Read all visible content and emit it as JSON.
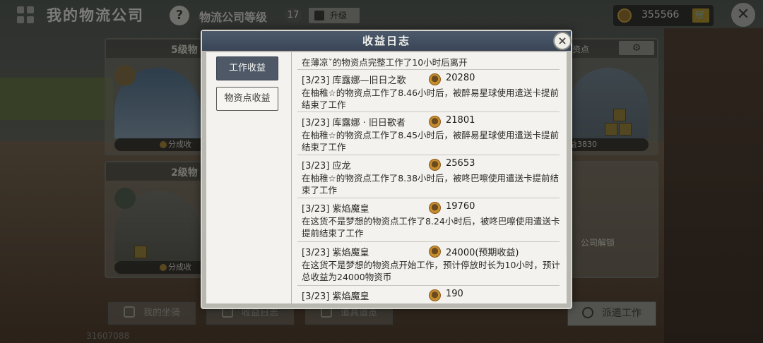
{
  "topbar": {
    "title": "我的物流公司",
    "help": "?",
    "level_label": "物流公司等级",
    "level_value": "17",
    "upgrade_label": "升级",
    "coins": "355566"
  },
  "cards": {
    "left_top_level": "5级物",
    "left_top_strip": "分成收",
    "left_bottom_level": "2级物",
    "left_bottom_strip": "分成收",
    "right_top_label": "资点",
    "right_top_strip": "益3830",
    "right_bottom_label": "公司解锁"
  },
  "bottom": {
    "mount_label": "我的坐骑",
    "log_label": "收益日志",
    "items_label": "道具道览",
    "dispatch_label": "派遣工作",
    "uid": "31607088"
  },
  "modal": {
    "title": "收益日志",
    "close": "×",
    "tabs": [
      "工作收益",
      "物资点收益"
    ],
    "top_partial": "在薄凉ˇ的物资点完整工作了10小时后离开",
    "entries": [
      {
        "date_name": "[3/23] 库露娜—旧日之歌",
        "amount": "20280",
        "desc": "在柚稚☆的物资点工作了8.46小时后，被醉易星球使用遣送卡提前结束了工作"
      },
      {
        "date_name": "[3/23] 库露娜 · 旧日歌者",
        "amount": "21801",
        "desc": "在柚稚☆的物资点工作了8.45小时后，被醉易星球使用遣送卡提前结束了工作"
      },
      {
        "date_name": "[3/23] 应龙",
        "amount": "25653",
        "desc": "在柚稚☆的物资点工作了8.38小时后，被咚巴嚓使用遣送卡提前结束了工作"
      },
      {
        "date_name": "[3/23] 紫焰魔皇",
        "amount": "19760",
        "desc": "在这货不是梦想的物资点工作了8.24小时后，被咚巴嚓使用遣送卡提前结束了工作"
      },
      {
        "date_name": "[3/23] 紫焰魔皇",
        "amount": "24000(预期收益)",
        "desc": "在这货不是梦想的物资点开始工作，预计停放时长为10小时，预计总收益为24000物资币"
      },
      {
        "date_name": "[3/23] 紫焰魔皇",
        "amount": "190",
        "desc": ""
      }
    ]
  },
  "colors": {
    "modal_header": "#3a4656",
    "active_tab": "#4e5866",
    "coin": "#c78e2e"
  }
}
